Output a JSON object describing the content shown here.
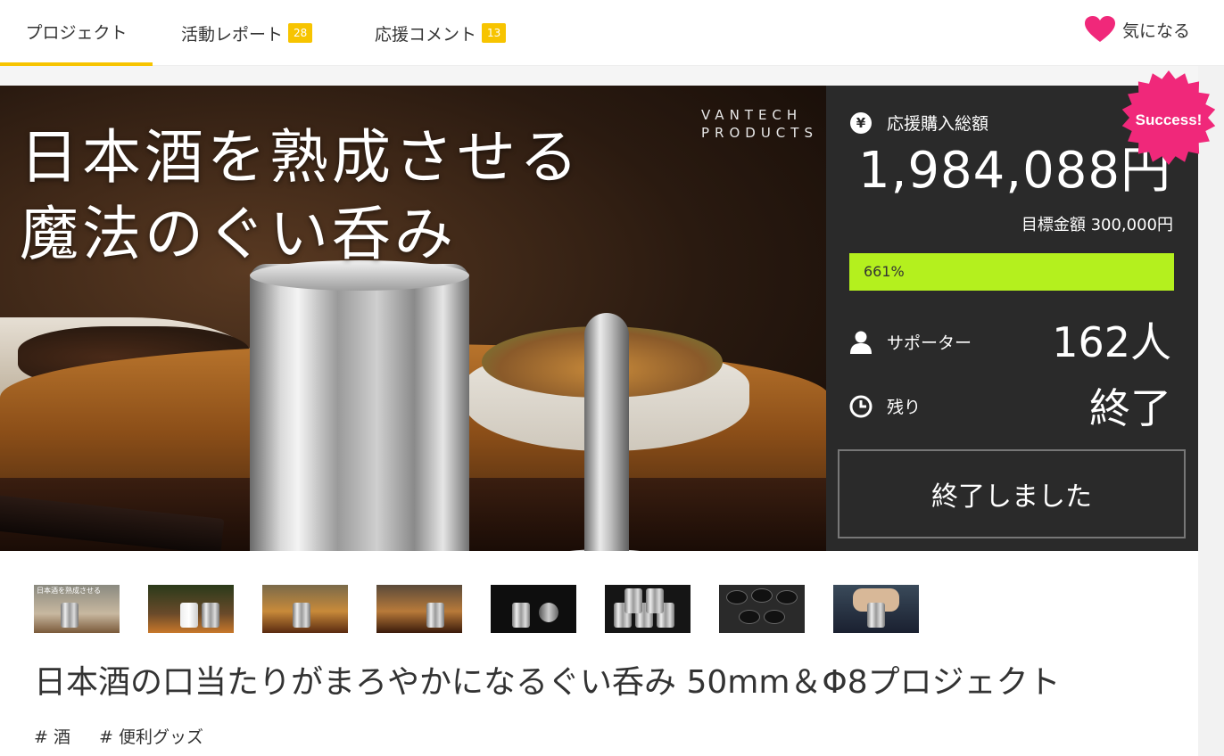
{
  "tabs": [
    {
      "label": "プロジェクト",
      "badge": null,
      "active": true
    },
    {
      "label": "活動レポート",
      "badge": "28",
      "active": false
    },
    {
      "label": "応援コメント",
      "badge": "13",
      "active": false
    }
  ],
  "favorite": {
    "label": "気になる",
    "icon": "heart-icon",
    "color": "#f0287a"
  },
  "hero": {
    "title_line1": "日本酒を熟成させる",
    "title_line2": "魔法のぐい呑み",
    "brand_line1": "VANTECH",
    "brand_line2": "PRODUCTS"
  },
  "stats": {
    "amount_label": "応援購入総額",
    "amount": "1,984,088円",
    "goal_label": "目標金額 300,000円",
    "progress_text": "661%",
    "progress_fraction": 1.0,
    "supporters_label": "サポーター",
    "supporters_value": "162人",
    "remaining_label": "残り",
    "remaining_value": "終了",
    "ended_button": "終了しました",
    "success_badge": "Success!",
    "progress_color": "#b4f01e",
    "badge_color": "#f0287a"
  },
  "thumbnails": [
    {
      "name": "thumbnail-1",
      "caption": "日本酒を熟成させる"
    },
    {
      "name": "thumbnail-2",
      "caption": ""
    },
    {
      "name": "thumbnail-3",
      "caption": ""
    },
    {
      "name": "thumbnail-4",
      "caption": ""
    },
    {
      "name": "thumbnail-5",
      "caption": ""
    },
    {
      "name": "thumbnail-6",
      "caption": ""
    },
    {
      "name": "thumbnail-7",
      "caption": ""
    },
    {
      "name": "thumbnail-8",
      "caption": ""
    }
  ],
  "project_title": "日本酒の口当たりがまろやかになるぐい呑み 50mm＆Φ8プロジェクト",
  "tags": [
    "# 酒",
    "# 便利グッズ"
  ],
  "accent_color": "#f7c400"
}
